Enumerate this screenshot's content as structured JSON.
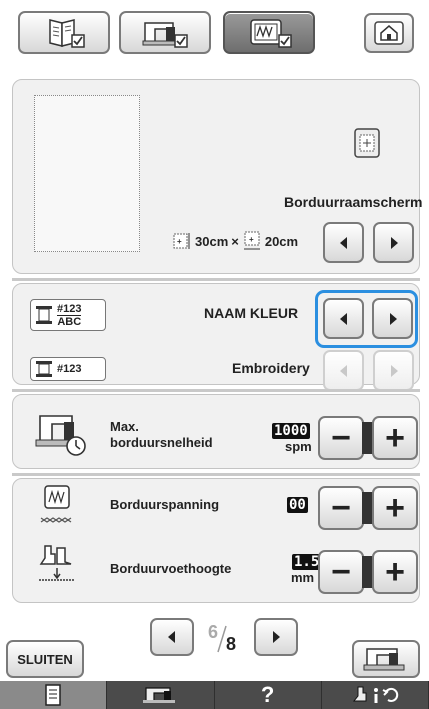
{
  "top_tabs": [
    {
      "name": "tab-general-settings",
      "selected": false
    },
    {
      "name": "tab-sewing-settings",
      "selected": false
    },
    {
      "name": "tab-embroidery-settings",
      "selected": true
    }
  ],
  "frame_section": {
    "frame_display_label": "Borduurraamscherm",
    "size_width": "30cm",
    "size_sep": "×",
    "size_height": "20cm"
  },
  "thread_display": {
    "icon_number": "#123",
    "icon_abc": "ABC",
    "value": "NAAM KLEUR"
  },
  "thread_number": {
    "icon_number": "#123",
    "value": "Embroidery"
  },
  "max_speed": {
    "label_line1": "Max.",
    "label_line2": "borduursnelheid",
    "value": "1000",
    "unit": "spm"
  },
  "tension": {
    "label": "Borduurspanning",
    "value": "00"
  },
  "foot_height": {
    "label": "Borduurvoethoogte",
    "value": "1.5",
    "unit": "mm"
  },
  "pagination": {
    "current": "6",
    "total": "8"
  },
  "buttons": {
    "close_label": "SLUITEN",
    "minus": "−",
    "plus": "+"
  },
  "bottom_bar": {
    "help_label": "?"
  },
  "colors": {
    "highlight": "#2b8fe0",
    "panel": "#f1f1f1",
    "bottom_bar": "#4b4b4b"
  }
}
